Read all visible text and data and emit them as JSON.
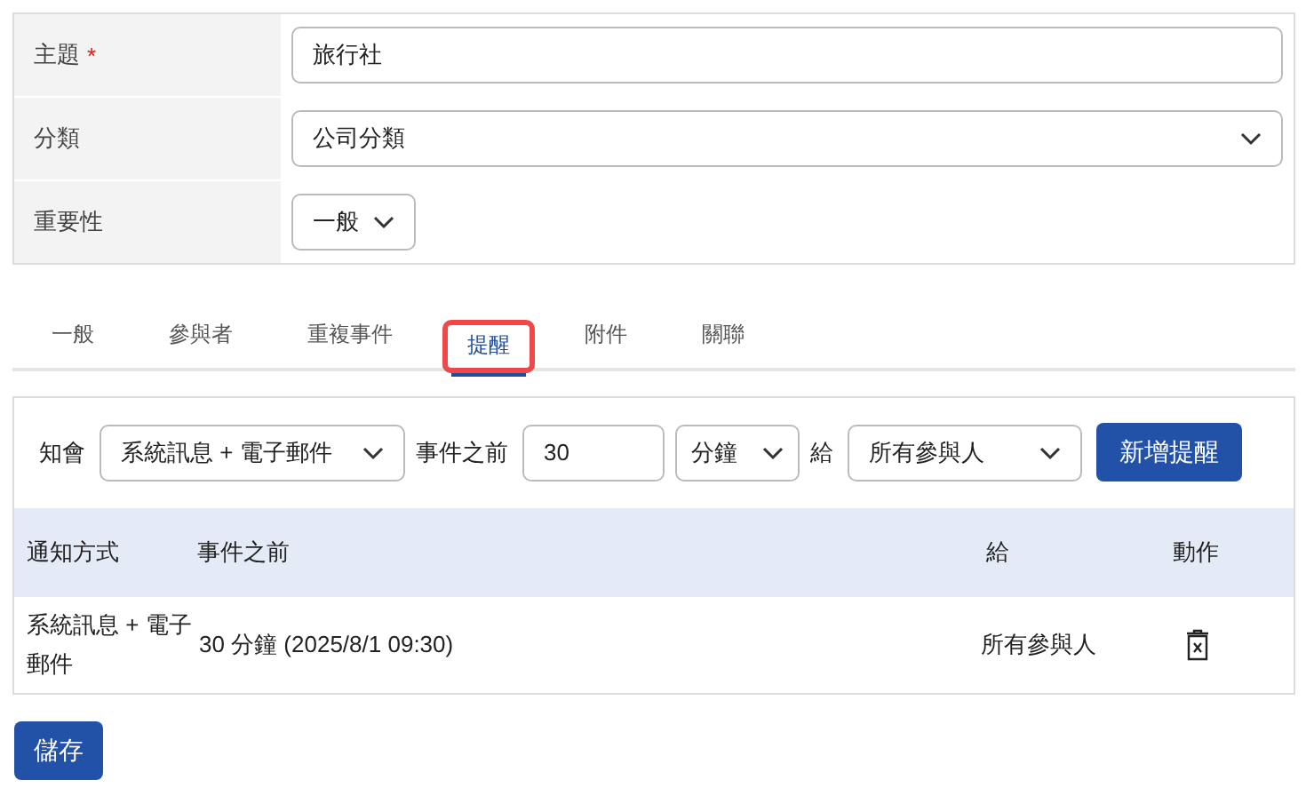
{
  "form": {
    "rows": [
      {
        "kind": "text",
        "label": "主題",
        "required_mark": "*",
        "value": "旅行社"
      },
      {
        "kind": "select",
        "label": "分類",
        "value": "公司分類",
        "wide": true
      },
      {
        "kind": "select",
        "label": "重要性",
        "value": "一般",
        "wide": false
      }
    ]
  },
  "tabs": [
    {
      "label": "一般",
      "selected": false,
      "highlighted": false
    },
    {
      "label": "參與者",
      "selected": false,
      "highlighted": false
    },
    {
      "label": "重複事件",
      "selected": false,
      "highlighted": false
    },
    {
      "label": "提醒",
      "selected": true,
      "highlighted": true
    },
    {
      "label": "附件",
      "selected": false,
      "highlighted": false
    },
    {
      "label": "關聯",
      "selected": false,
      "highlighted": false
    }
  ],
  "reminder": {
    "notify_label": "知會",
    "notify_value": "系統訊息 + 電子郵件",
    "before_label": "事件之前",
    "before_value": "30",
    "unit_value": "分鐘",
    "to_label": "給",
    "to_value": "所有參與人",
    "add_button": "新增提醒",
    "table": {
      "columns": [
        "通知方式",
        "事件之前",
        "給",
        "動作"
      ],
      "rows": [
        {
          "method": "系統訊息 + 電子郵件",
          "before": "30 分鐘  (2025/8/1 09:30)",
          "to": "所有參與人"
        }
      ]
    }
  },
  "save_button": "儲存"
}
